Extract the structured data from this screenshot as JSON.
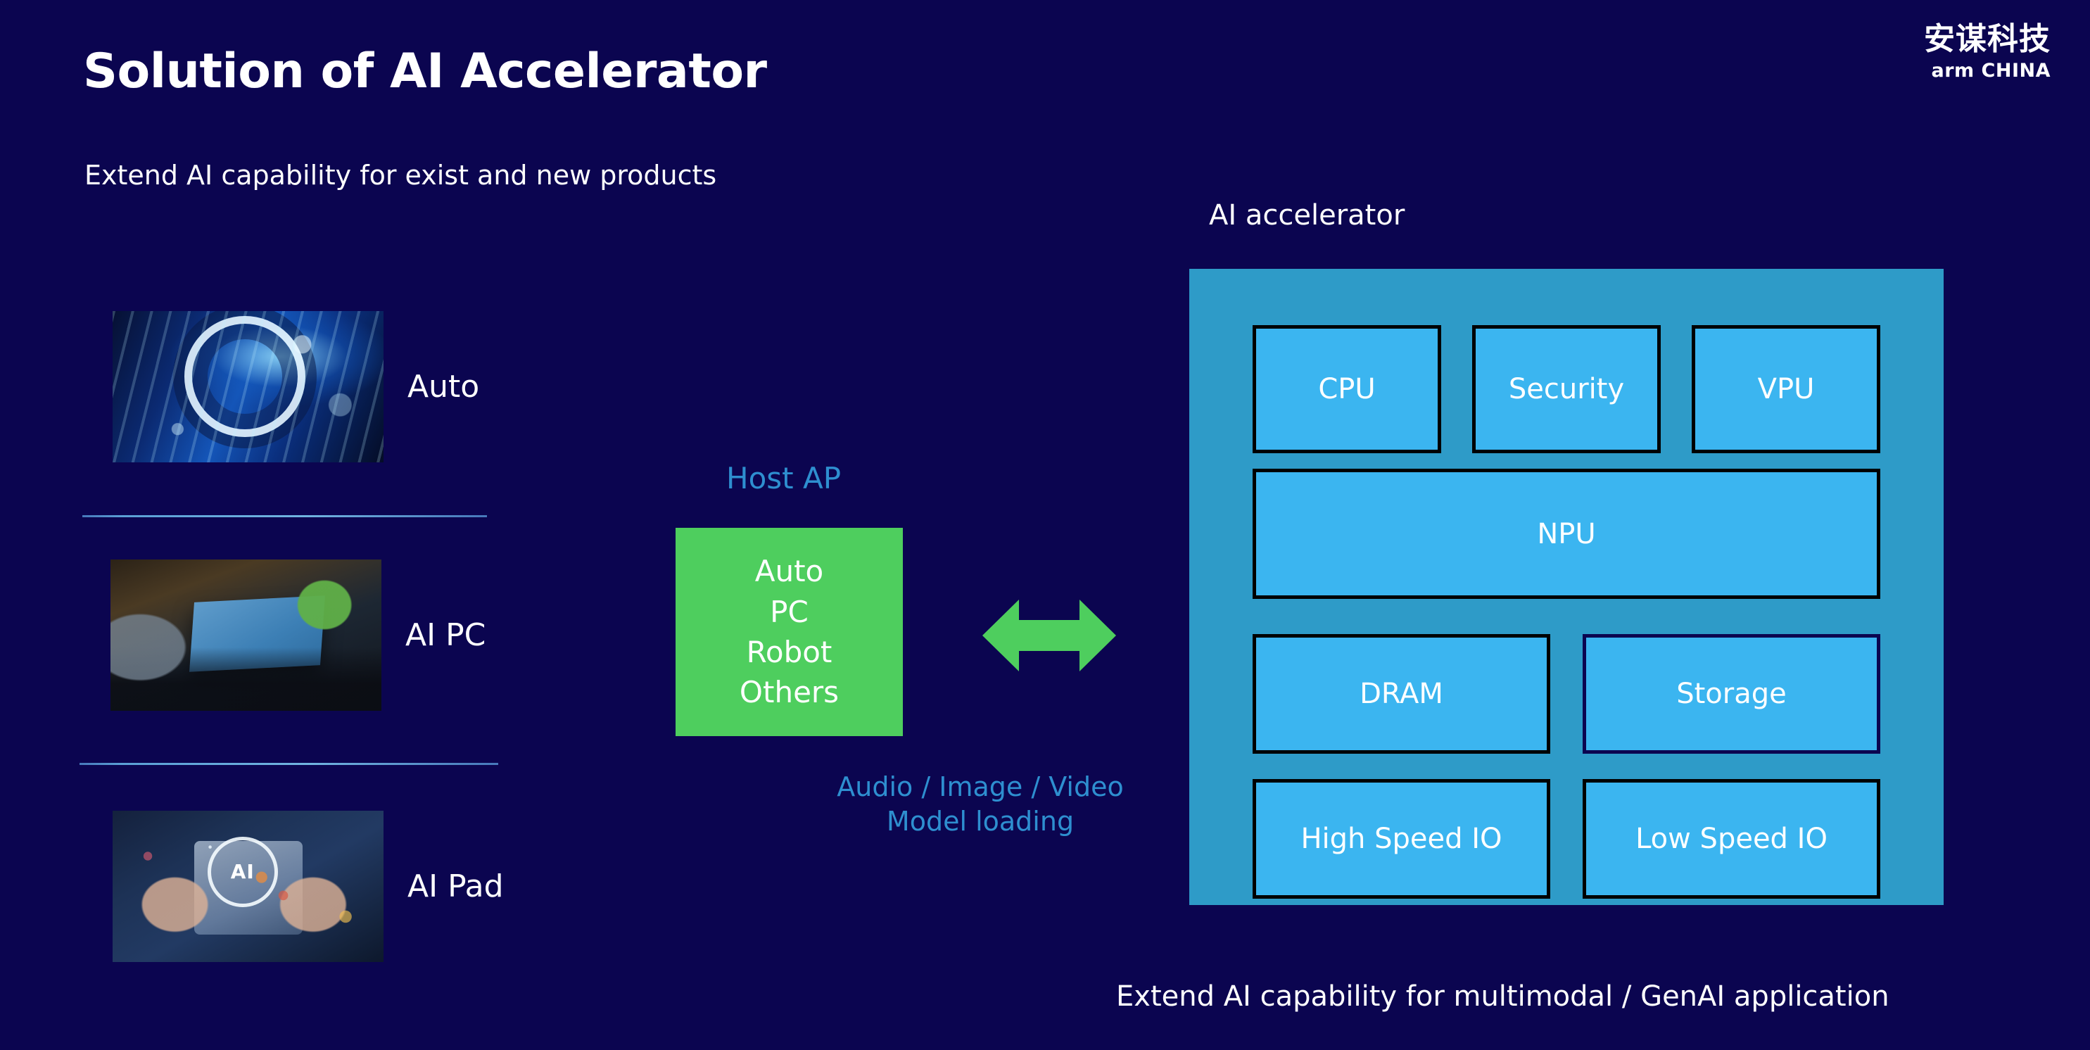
{
  "header": {
    "title": "Solution of AI Accelerator",
    "subtitle": "Extend AI capability for exist and new products"
  },
  "logo": {
    "chinese": "安谋科技",
    "english": "arm CHINA"
  },
  "products": [
    {
      "label": "Auto",
      "image": "automotive-cockpit-photo"
    },
    {
      "label": "AI PC",
      "image": "laptop-dashboard-photo"
    },
    {
      "label": "AI Pad",
      "image": "tablet-in-hands-photo"
    }
  ],
  "host_ap": {
    "title": "Host AP",
    "items": [
      "Auto",
      "PC",
      "Robot",
      "Others"
    ],
    "notes_line1": "Audio / Image / Video",
    "notes_line2": "Model loading"
  },
  "connector": {
    "icon": "bidirectional-arrow-icon"
  },
  "accelerator": {
    "title": "AI accelerator",
    "caption": "Extend AI capability for multimodal / GenAI application",
    "top_row": [
      "CPU",
      "Security",
      "VPU"
    ],
    "npu": "NPU",
    "memory_row": [
      "DRAM",
      "Storage"
    ],
    "io_row": [
      "High Speed IO",
      "Low Speed IO"
    ]
  },
  "colors": {
    "background": "#0B0550",
    "host_ap_green": "#4ECE5E",
    "accent_blue": "#2E8FD0",
    "panel_blue": "#2E9BC8",
    "block_blue": "#3BB5F0",
    "divider_blue": "#5FA8DD",
    "text_white": "#FFFFFF",
    "block_border": "#000000"
  },
  "ai_badge_text": "AI"
}
